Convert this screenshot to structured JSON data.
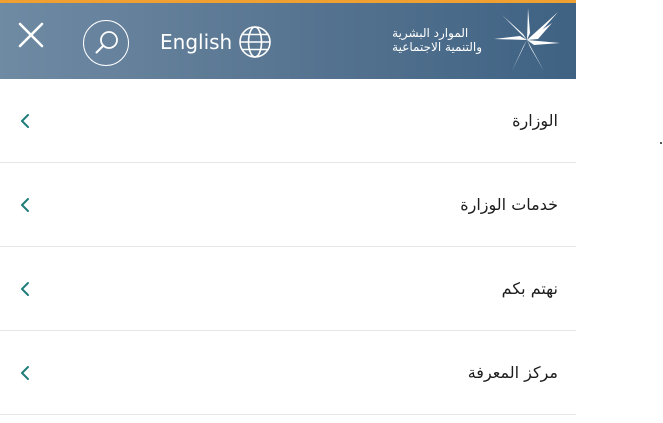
{
  "header": {
    "language_label": "English",
    "brand_line1": "الموارد البشرية",
    "brand_line2": "والتنمية الاجتماعية",
    "accent_color": "#f0a030",
    "close_icon": "close-icon",
    "search_icon": "search-icon",
    "globe_icon": "globe-icon",
    "logo_icon": "ministry-logo-icon"
  },
  "menu": {
    "items": [
      {
        "label": "الوزارة"
      },
      {
        "label": "خدمات الوزارة"
      },
      {
        "label": "نهتم بكم"
      },
      {
        "label": "مركز المعرفة"
      }
    ],
    "chevron_color": "#1f7d7a"
  }
}
